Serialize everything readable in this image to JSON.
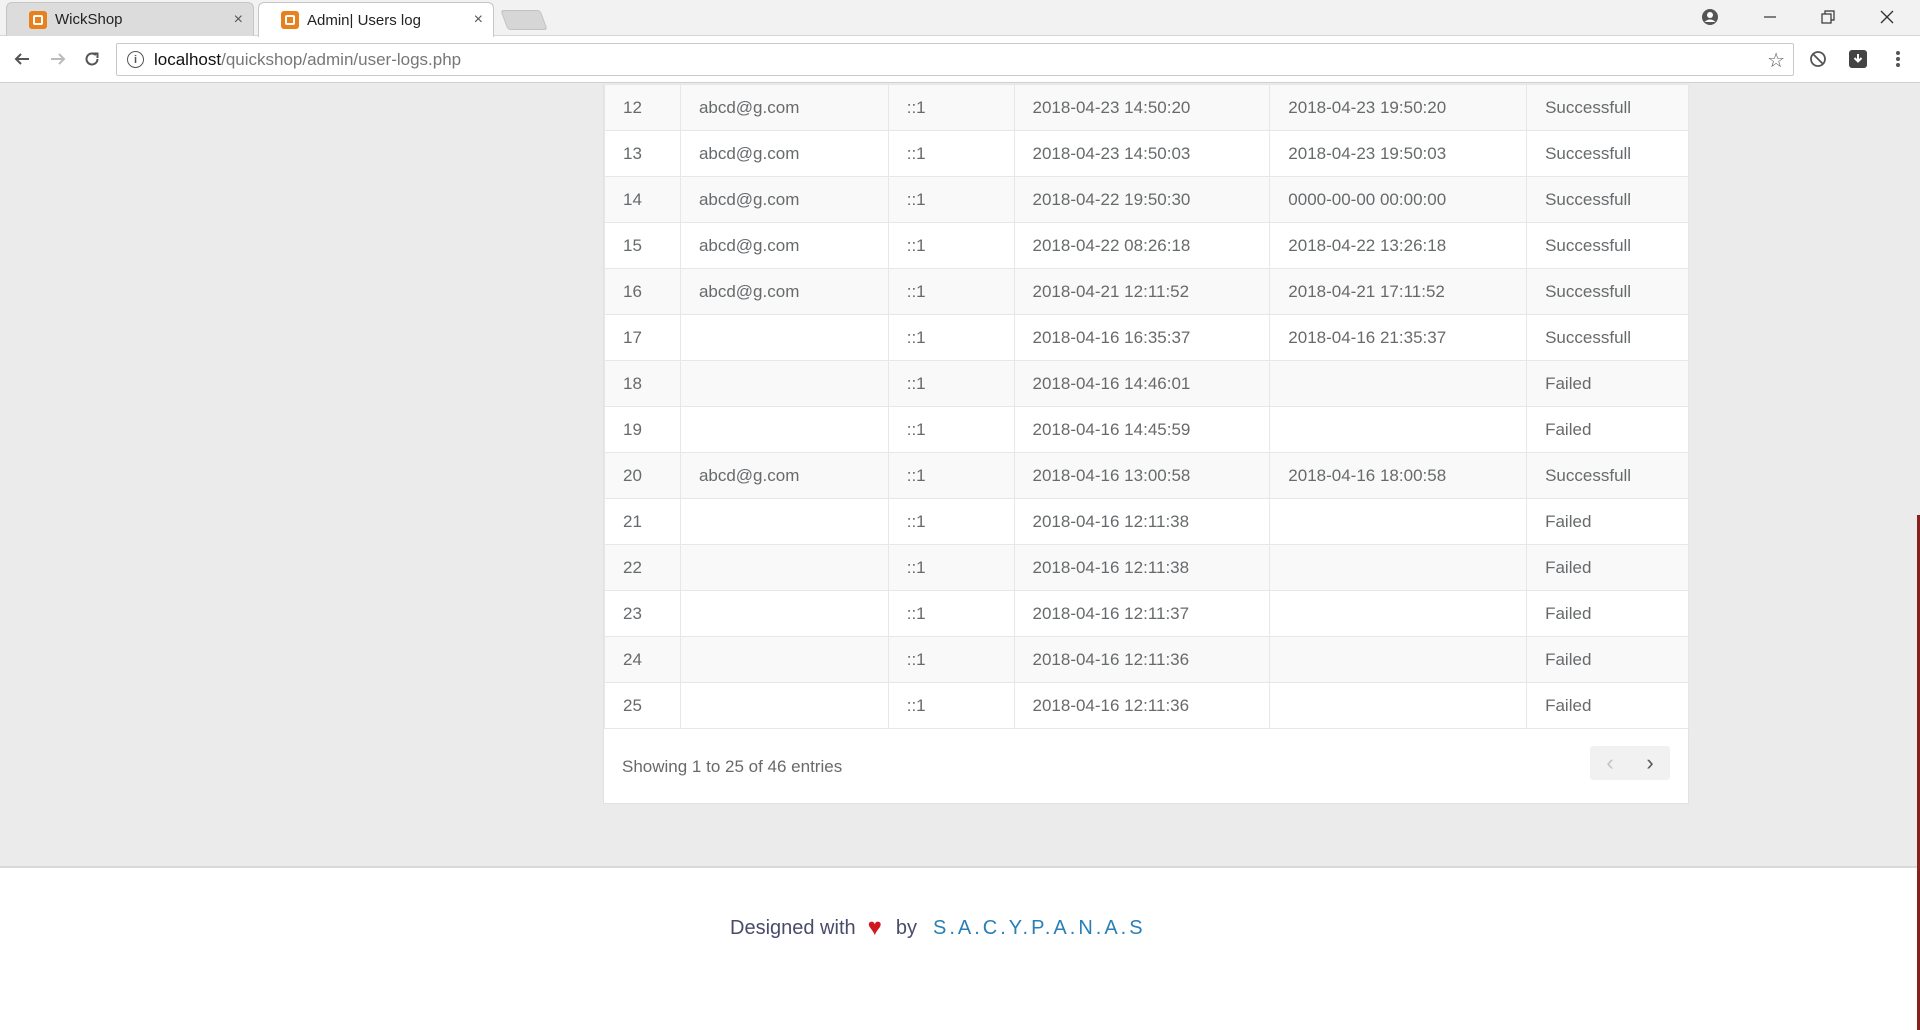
{
  "browser": {
    "tabs": [
      {
        "title": "WickShop",
        "active": false
      },
      {
        "title": "Admin| Users log",
        "active": true
      }
    ],
    "tab_close_glyph": "×",
    "address": {
      "host": "localhost",
      "path": "/quickshop/admin/user-logs.php"
    },
    "icons": {
      "back": "back-arrow-icon",
      "forward": "forward-arrow-icon",
      "reload": "reload-icon",
      "info": "info-icon",
      "star": "star-icon",
      "profile": "profile-icon",
      "block": "block-icon",
      "extension": "extension-icon",
      "menu": "kebab-menu-icon"
    }
  },
  "user_log": {
    "rows": [
      {
        "id": "12",
        "email": "abcd@g.com",
        "ip": "::1",
        "login": "2018-04-23 14:50:20",
        "logout": "2018-04-23 19:50:20",
        "status": "Successfull"
      },
      {
        "id": "13",
        "email": "abcd@g.com",
        "ip": "::1",
        "login": "2018-04-23 14:50:03",
        "logout": "2018-04-23 19:50:03",
        "status": "Successfull"
      },
      {
        "id": "14",
        "email": "abcd@g.com",
        "ip": "::1",
        "login": "2018-04-22 19:50:30",
        "logout": "0000-00-00 00:00:00",
        "status": "Successfull"
      },
      {
        "id": "15",
        "email": "abcd@g.com",
        "ip": "::1",
        "login": "2018-04-22 08:26:18",
        "logout": "2018-04-22 13:26:18",
        "status": "Successfull"
      },
      {
        "id": "16",
        "email": "abcd@g.com",
        "ip": "::1",
        "login": "2018-04-21 12:11:52",
        "logout": "2018-04-21 17:11:52",
        "status": "Successfull"
      },
      {
        "id": "17",
        "email": "",
        "ip": "::1",
        "login": "2018-04-16 16:35:37",
        "logout": "2018-04-16 21:35:37",
        "status": "Successfull"
      },
      {
        "id": "18",
        "email": "",
        "ip": "::1",
        "login": "2018-04-16 14:46:01",
        "logout": "",
        "status": "Failed"
      },
      {
        "id": "19",
        "email": "",
        "ip": "::1",
        "login": "2018-04-16 14:45:59",
        "logout": "",
        "status": "Failed"
      },
      {
        "id": "20",
        "email": "abcd@g.com",
        "ip": "::1",
        "login": "2018-04-16 13:00:58",
        "logout": "2018-04-16 18:00:58",
        "status": "Successfull"
      },
      {
        "id": "21",
        "email": "",
        "ip": "::1",
        "login": "2018-04-16 12:11:38",
        "logout": "",
        "status": "Failed"
      },
      {
        "id": "22",
        "email": "",
        "ip": "::1",
        "login": "2018-04-16 12:11:38",
        "logout": "",
        "status": "Failed"
      },
      {
        "id": "23",
        "email": "",
        "ip": "::1",
        "login": "2018-04-16 12:11:37",
        "logout": "",
        "status": "Failed"
      },
      {
        "id": "24",
        "email": "",
        "ip": "::1",
        "login": "2018-04-16 12:11:36",
        "logout": "",
        "status": "Failed"
      },
      {
        "id": "25",
        "email": "",
        "ip": "::1",
        "login": "2018-04-16 12:11:36",
        "logout": "",
        "status": "Failed"
      }
    ],
    "info": "Showing 1 to 25 of 46 entries",
    "pager": {
      "prev": "‹",
      "next": "›"
    }
  },
  "footer": {
    "designed_with": "Designed with",
    "heart": "♥",
    "by": "by",
    "author": "S.A.C.Y.P.A.N.A.S"
  },
  "colors": {
    "heart": "#d0191f",
    "author_link": "#2a7fb8",
    "favicon": "#e8801c"
  }
}
